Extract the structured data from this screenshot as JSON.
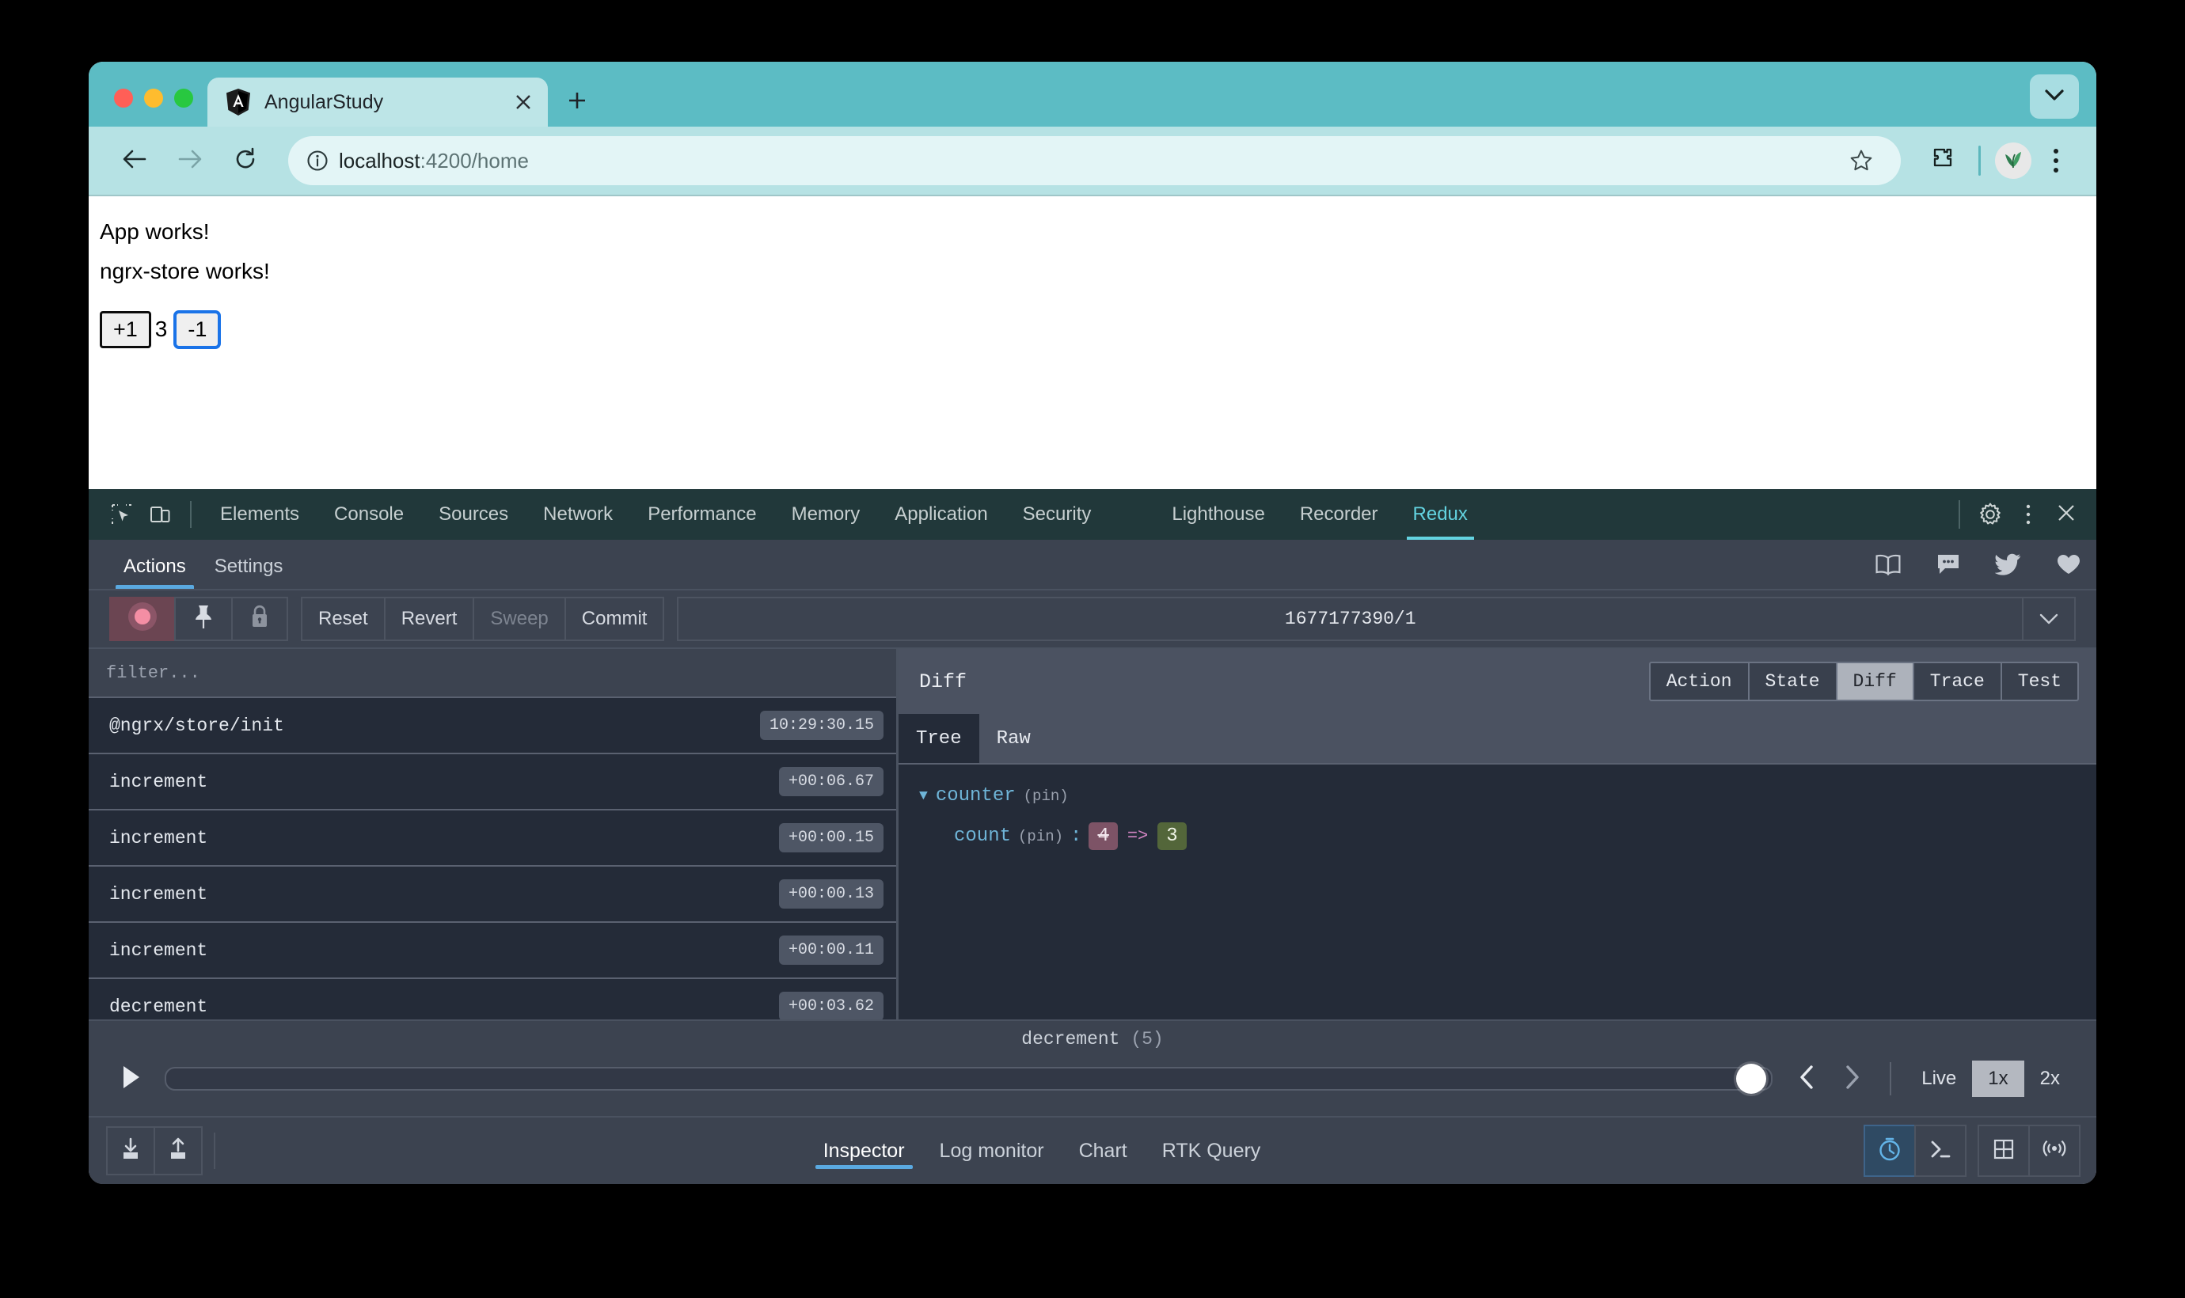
{
  "browser": {
    "tab": {
      "title": "AngularStudy",
      "favicon_icon": "angular-logo-icon",
      "close_icon": "close-icon"
    },
    "new_tab_icon": "plus-icon",
    "tab_search_icon": "chevron-down-icon",
    "toolbar": {
      "back_icon": "arrow-left-icon",
      "forward_icon": "arrow-right-icon",
      "reload_icon": "reload-icon",
      "info_icon": "info-circle-icon",
      "url_host": "localhost",
      "url_path": ":4200/home",
      "star_icon": "star-icon",
      "extensions_icon": "puzzle-piece-icon",
      "profile_icon": "avatar-plant-icon",
      "menu_icon": "kebab-menu-icon"
    }
  },
  "page": {
    "line1": "App works!",
    "line2": "ngrx-store works!",
    "increment_label": "+1",
    "count_value": "3",
    "decrement_label": "-1"
  },
  "devtools": {
    "inspect_icon": "inspect-element-icon",
    "device_icon": "device-toolbar-icon",
    "tabs": [
      {
        "label": "Elements",
        "active": false
      },
      {
        "label": "Console",
        "active": false
      },
      {
        "label": "Sources",
        "active": false
      },
      {
        "label": "Network",
        "active": false
      },
      {
        "label": "Performance",
        "active": false
      },
      {
        "label": "Memory",
        "active": false
      },
      {
        "label": "Application",
        "active": false
      },
      {
        "label": "Security",
        "active": false
      },
      {
        "label": "Lighthouse",
        "active": false
      },
      {
        "label": "Recorder",
        "active": false
      },
      {
        "label": "Redux",
        "active": true
      }
    ],
    "settings_icon": "gear-icon",
    "more_icon": "kebab-menu-icon",
    "close_icon": "close-icon"
  },
  "redux": {
    "subtabs": [
      {
        "label": "Actions",
        "active": true
      },
      {
        "label": "Settings",
        "active": false
      }
    ],
    "social": [
      {
        "icon": "book-icon"
      },
      {
        "icon": "chat-bubble-icon"
      },
      {
        "icon": "twitter-bird-icon"
      },
      {
        "icon": "heart-icon"
      }
    ],
    "toolbar": {
      "record_icon": "record-circle-icon",
      "pin_icon": "pin-icon",
      "lock_icon": "lock-icon",
      "reset_label": "Reset",
      "revert_label": "Revert",
      "sweep_label": "Sweep",
      "commit_label": "Commit",
      "instance_value": "1677177390/1",
      "instance_caret_icon": "chevron-down-icon"
    },
    "filter_placeholder": "filter...",
    "actions": [
      {
        "name": "@ngrx/store/init",
        "time": "10:29:30.15"
      },
      {
        "name": "increment",
        "time": "+00:06.67"
      },
      {
        "name": "increment",
        "time": "+00:00.15"
      },
      {
        "name": "increment",
        "time": "+00:00.13"
      },
      {
        "name": "increment",
        "time": "+00:00.11"
      },
      {
        "name": "decrement",
        "time": "+00:03.62"
      }
    ],
    "diff": {
      "title": "Diff",
      "views": [
        {
          "label": "Action",
          "active": false
        },
        {
          "label": "State",
          "active": false
        },
        {
          "label": "Diff",
          "active": true
        },
        {
          "label": "Trace",
          "active": false
        },
        {
          "label": "Test",
          "active": false
        }
      ],
      "format_tabs": [
        {
          "label": "Tree",
          "active": true
        },
        {
          "label": "Raw",
          "active": false
        }
      ],
      "tree": {
        "root_key": "counter",
        "root_meta": "(pin)",
        "child_key": "count",
        "child_meta": "(pin)",
        "old_value": "4",
        "arrow": "=>",
        "new_value": "3"
      }
    },
    "playback": {
      "current_action": "decrement",
      "current_index": "(5)",
      "play_icon": "play-icon",
      "prev_icon": "chevron-left-icon",
      "next_icon": "chevron-right-icon",
      "live_label": "Live",
      "speed_1x": "1x",
      "speed_2x": "2x"
    },
    "footer": {
      "import_icon": "import-icon",
      "export_icon": "export-icon",
      "tabs": [
        {
          "label": "Inspector",
          "active": true
        },
        {
          "label": "Log monitor",
          "active": false
        },
        {
          "label": "Chart",
          "active": false
        },
        {
          "label": "RTK Query",
          "active": false
        }
      ],
      "mode_buttons": [
        {
          "icon": "timer-icon",
          "active": true
        },
        {
          "icon": "terminal-icon",
          "active": false
        },
        {
          "icon": "grid-layout-icon",
          "active": false
        },
        {
          "icon": "broadcast-icon",
          "active": false
        }
      ]
    }
  },
  "colors": {
    "browser_chrome": "#5cbcc4",
    "devtools_tabbar": "#21383a",
    "redux_panel": "#3c4350",
    "accent_cyan": "#63d3e0",
    "accent_blue": "#5aa9e0",
    "diff_removed": "#7d5366",
    "diff_added": "#53663a"
  }
}
